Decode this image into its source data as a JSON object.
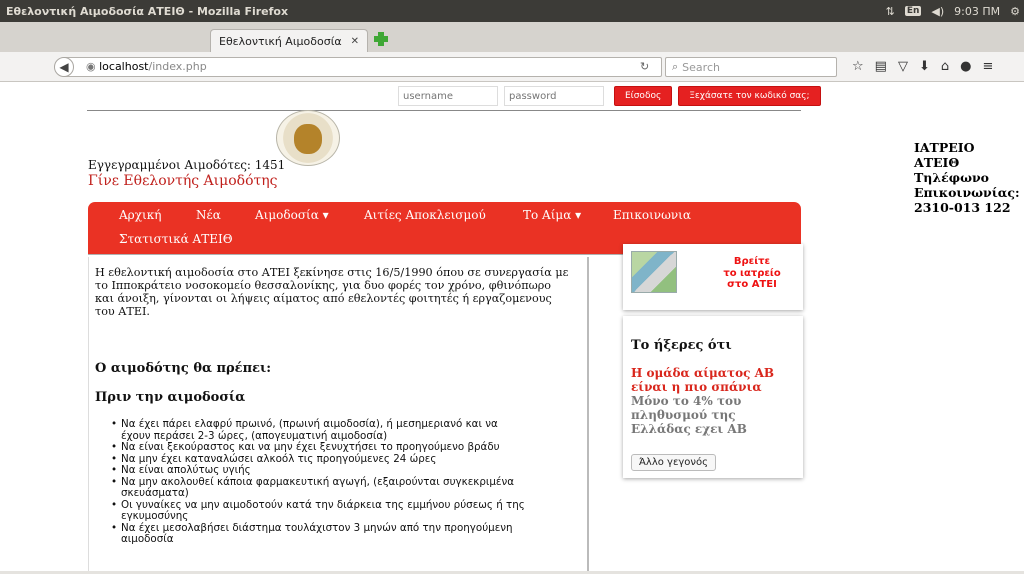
{
  "os": {
    "window_title": "Εθελοντική Αιμοδοσία ΑΤΕΙΘ - Mozilla Firefox",
    "keyboard_layout": "En",
    "volume_icon": "◀)",
    "time": "9:03 ΠΜ"
  },
  "browser": {
    "tab_title": "Εθελοντική Αιμοδοσία ...",
    "url_host": "localhost",
    "url_path": "/index.php",
    "search_placeholder": "Search"
  },
  "login": {
    "username_placeholder": "username",
    "password_placeholder": "password",
    "login_label": "Είσοδος",
    "forgot_label": "Ξεχάσατε τον κωδικό σας;"
  },
  "header": {
    "donors_count": "Εγγεγραμμένοι Αιμοδότες: 1451",
    "become_donor": "Γίνε Εθελοντής Αιμοδότης"
  },
  "infirmary": {
    "line1": "ΙΑΤΡΕΙΟ",
    "line2": "ΑΤΕΙΘ",
    "line3": "Τηλέφωνο",
    "line4": "Επικοινωνίας:",
    "line5": "2310-013 122"
  },
  "menu": {
    "home": "Αρχική",
    "news": "Νέα",
    "donation": "Αιμοδοσία ▾",
    "exclusion": "Αιτίες Αποκλεισμού",
    "blood": "Το Αίμα ▾",
    "contact": "Επικοινωνια",
    "stats": "Στατιστικά ΑΤΕΙΘ"
  },
  "content": {
    "intro_line1": "Η εθελοντική αιμοδοσία στο ΑΤΕΙ ξεκίνησε στις 16/5/1990 όπου σε συνεργασία με",
    "intro_line2": "το Ιπποκράτειο νοσοκομείο θεσσαλονίκης, για δυο φορές τον χρόνο, φθινόπωρο",
    "intro_line3": "και άνοιξη, γίνονται οι λήψεις αίματος από εθελοντές φοιτητές ή εργαζομενους",
    "intro_line4": "του ΑΤΕΙ.",
    "heading_should": "Ο αιμοδότης θα πρέπει:",
    "heading_before": "Πριν την αιμοδοσία",
    "rules": [
      [
        "Να έχει πάρει ελαφρύ πρωινό, (πρωινή αιμοδοσία), ή μεσημεριανό και να",
        "έχουν περάσει 2-3 ώρες, (απογευματινή αιμοδοσία)"
      ],
      [
        "Να είναι ξεκούραστος και να μην έχει ξενυχτήσει το προηγούμενο βράδυ",
        ""
      ],
      [
        "Να μην έχει καταναλώσει αλκοόλ τις προηγούμενες 24 ώρες",
        ""
      ],
      [
        "Να είναι απολύτως υγιής",
        ""
      ],
      [
        "Να μην ακολουθεί κάποια φαρμακευτική αγωγή, (εξαιρούνται συγκεκριμένα",
        "σκευάσματα)"
      ],
      [
        "Οι γυναίκες να μην αιμοδοτούν κατά την διάρκεια της εμμήνου ρύσεως ή της",
        "εγκυμοσύνης"
      ],
      [
        "Να έχει μεσολαβήσει διάστημα τουλάχιστον 3 μηνών από την προηγούμενη",
        "αιμοδοσία"
      ]
    ]
  },
  "sidebar": {
    "map_line1": "Βρείτε",
    "map_line2": "το ιατρείο",
    "map_line3": "στο ΑΤΕΙ",
    "fact_title": "Το ήξερες ότι",
    "fact_red_line1": "Η ομάδα αίματος ΑΒ",
    "fact_red_line2": "είναι η πιο σπάνια",
    "fact_grey_line1": "Μόνο το 4% του",
    "fact_grey_line2": "πληθυσμού της",
    "fact_grey_line3": "Ελλάδας εχει ΑΒ",
    "fact_button": "Άλλο γεγονός"
  }
}
